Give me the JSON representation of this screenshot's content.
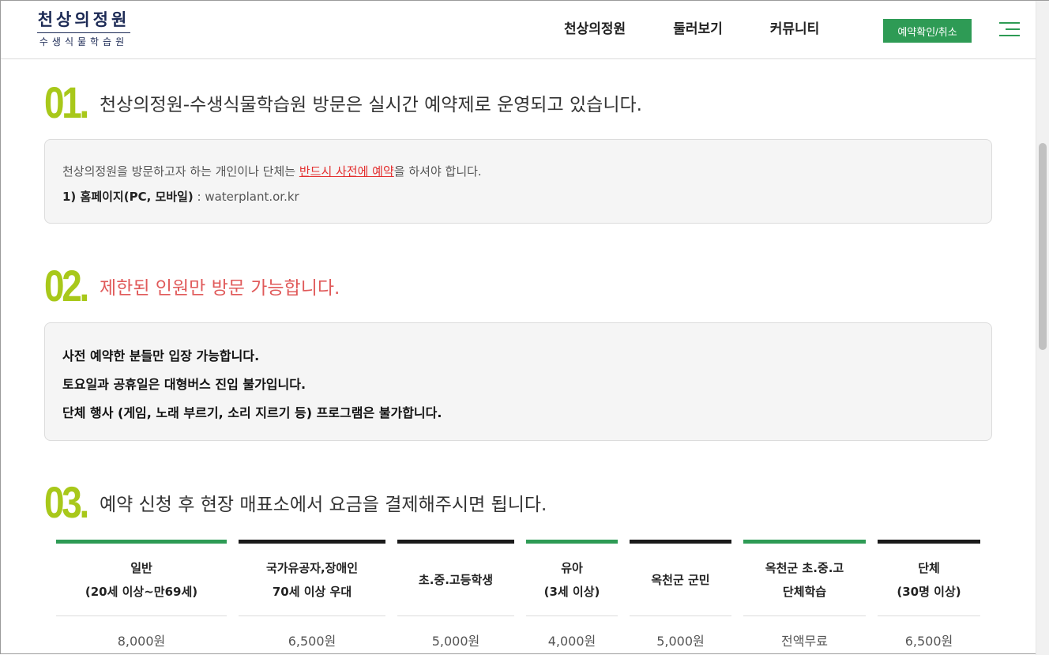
{
  "header": {
    "logo_main": "천상의정원",
    "logo_sub": "수생식물학습원",
    "nav": [
      "천상의정원",
      "둘러보기",
      "커뮤니티"
    ],
    "reserve_button": "예약확인/취소"
  },
  "section1": {
    "num": "01.",
    "title": "천상의정원-수생식물학습원 방문은 실시간 예약제로 운영되고 있습니다.",
    "line1_a": "천상의정원을 방문하고자 하는 개인이나 단체는 ",
    "line1_highlight": "반드시 사전에 예약",
    "line1_b": "을 하셔야 합니다.",
    "line2_strong": "1) 홈페이지(PC, 모바일)",
    "line2_rest": " : waterplant.or.kr"
  },
  "section2": {
    "num": "02.",
    "title": "제한된 인원만 방문 가능합니다.",
    "lines": [
      "사전 예약한 분들만 입장 가능합니다.",
      "토요일과 공휴일은 대형버스 진입 불가입니다.",
      "단체 행사 (게임, 노래 부르기, 소리 지르기 등) 프로그램은 불가합니다."
    ]
  },
  "section3": {
    "num": "03.",
    "title": "예약 신청 후 현장 매표소에서 요금을 결제해주시면 됩니다.",
    "prices": [
      {
        "line1": "일반",
        "line2": "(20세 이상~만69세)",
        "price": "8,000원",
        "bar_color": "#2e9b55"
      },
      {
        "line1": "국가유공자,장애인",
        "line2": "70세 이상 우대",
        "price": "6,500원",
        "bar_color": "#1a1a1a"
      },
      {
        "line1": "초.중.고등학생",
        "line2": "",
        "price": "5,000원",
        "bar_color": "#1a1a1a"
      },
      {
        "line1": "유아",
        "line2": "(3세 이상)",
        "price": "4,000원",
        "bar_color": "#2e9b55"
      },
      {
        "line1": "옥천군 군민",
        "line2": "",
        "price": "5,000원",
        "bar_color": "#1a1a1a"
      },
      {
        "line1": "옥천군 초.중.고",
        "line2": "단체학습",
        "price": "전액무료",
        "bar_color": "#2e9b55"
      },
      {
        "line1": "단체",
        "line2": "(30명 이상)",
        "price": "6,500원",
        "bar_color": "#1a1a1a"
      }
    ]
  }
}
